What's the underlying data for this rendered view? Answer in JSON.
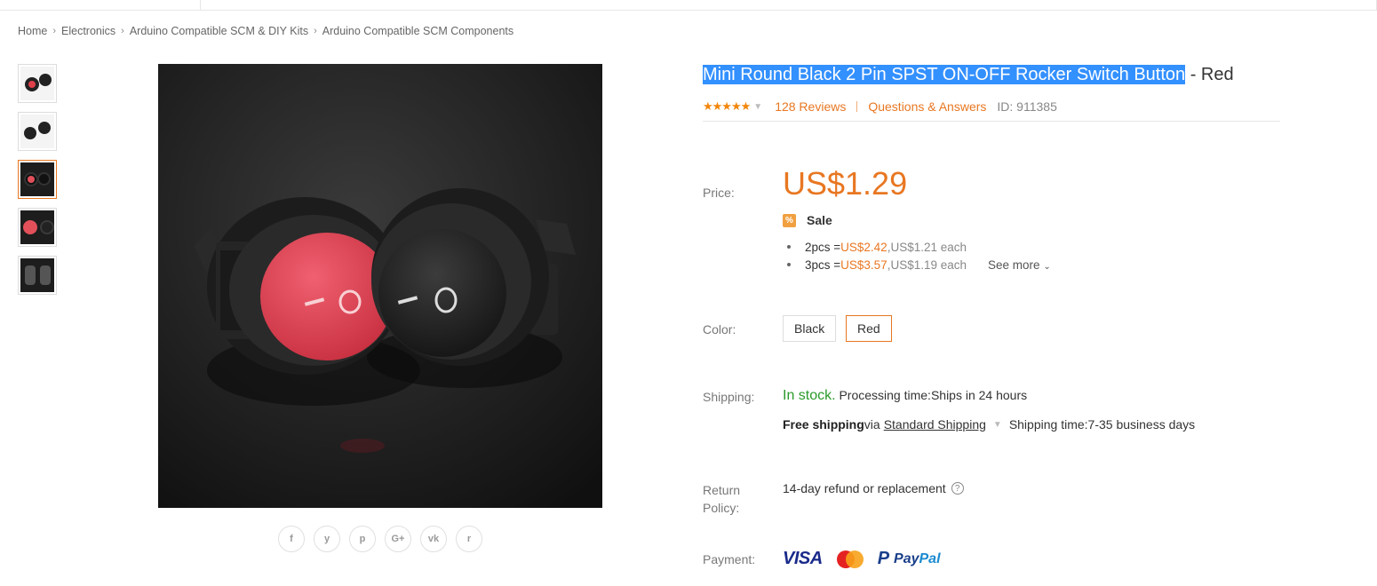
{
  "breadcrumb": [
    "Home",
    "Electronics",
    "Arduino Compatible SCM & DIY Kits",
    "Arduino Compatible SCM Components"
  ],
  "product": {
    "title_selected": "Mini Round Black 2 Pin SPST ON-OFF Rocker Switch Button",
    "title_variant": " - Red",
    "rating_stars": "★★★★★",
    "reviews": "128 Reviews",
    "qa": "Questions & Answers",
    "id": "ID: 911385"
  },
  "price": {
    "label": "Price:",
    "value": "US$1.29",
    "sale_icon": "%",
    "sale": "Sale",
    "tiers": [
      {
        "qty": "2pcs = ",
        "total": "US$2.42",
        "each": ",US$1.21 each"
      },
      {
        "qty": "3pcs = ",
        "total": "US$3.57",
        "each": ",US$1.19 each"
      }
    ],
    "see_more": "See more"
  },
  "color": {
    "label": "Color:",
    "options": [
      "Black",
      "Red"
    ],
    "selected": "Red"
  },
  "shipping": {
    "label": "Shipping:",
    "stock": "In stock.",
    "processing": " Processing time:Ships in 24 hours",
    "free": "Free shipping",
    "via": " via",
    "method": "Standard Shipping",
    "time": "Shipping time:7-35 business days"
  },
  "return": {
    "label_line1": "Return",
    "label_line2": "Policy:",
    "text": "14-day refund or replacement",
    "help": "?"
  },
  "payment": {
    "label": "Payment:",
    "visa": "VISA",
    "paypal_pay": "Pay",
    "paypal_pal": "Pal",
    "paypal_mark": "P"
  },
  "social": [
    "f",
    "y",
    "p",
    "G+",
    "vk",
    "r"
  ],
  "colors": {
    "accent": "#e87722",
    "highlight": "#3390ff",
    "instock": "#2a9a2a"
  }
}
